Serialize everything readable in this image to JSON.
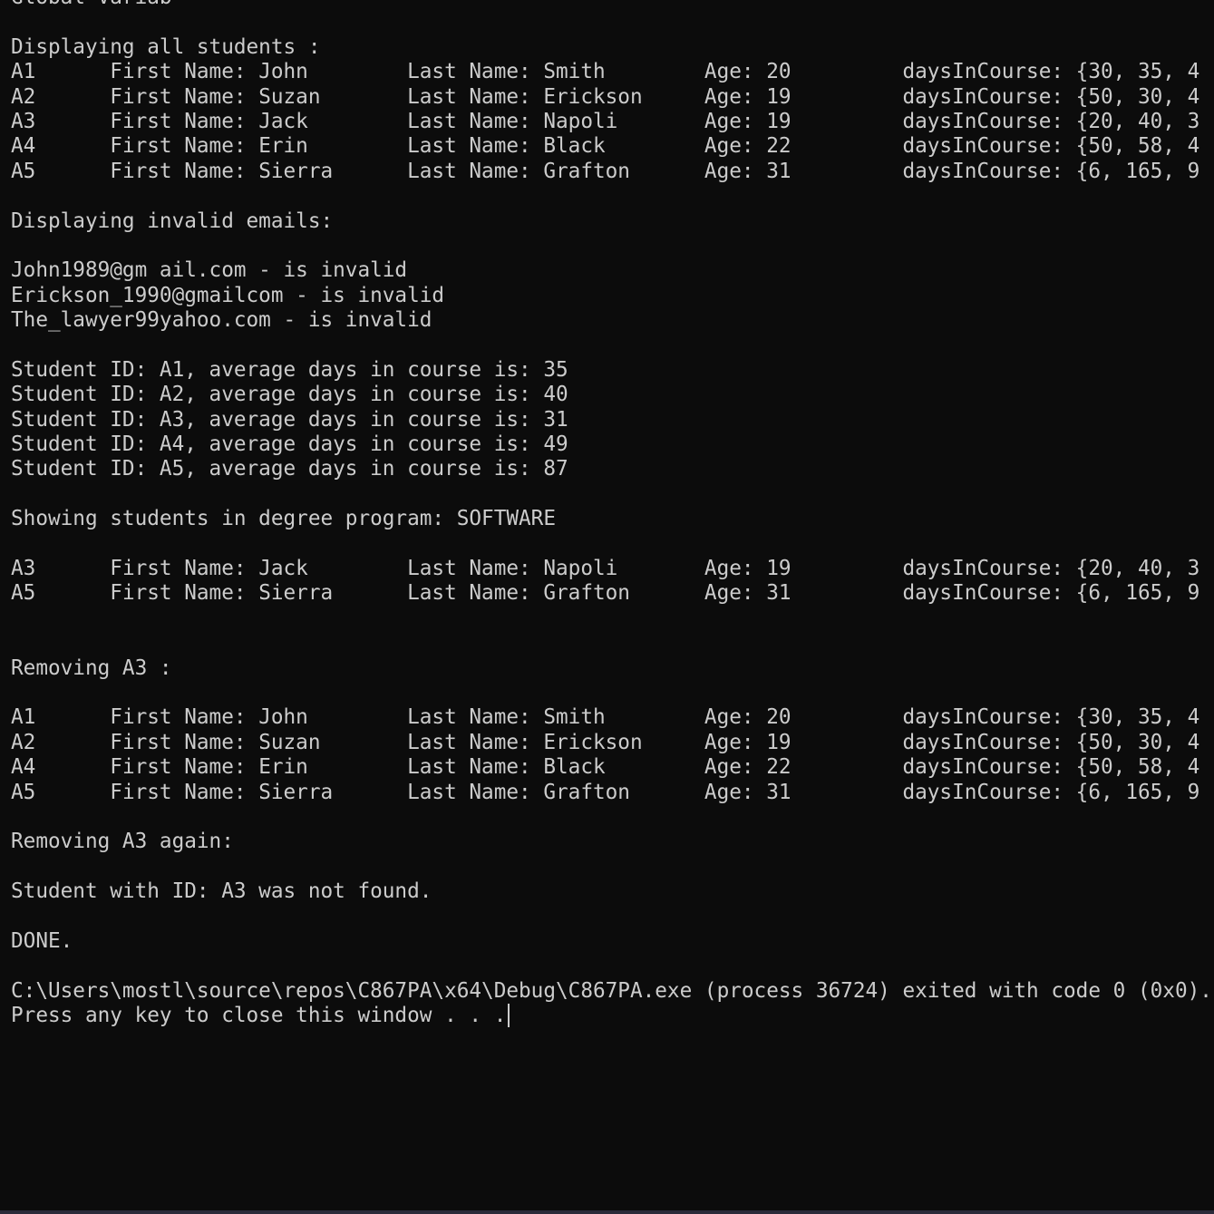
{
  "terminal": {
    "colors": {
      "background": "#0c0c0c",
      "foreground": "#cccccc"
    },
    "lines": [
      "Global Variab",
      "",
      "Displaying all students :",
      "A1\tFirst Name: John\tLast Name: Smith\tAge: 20\t\tdaysInCourse: {30, 35, 4",
      "A2\tFirst Name: Suzan\tLast Name: Erickson\tAge: 19\t\tdaysInCourse: {50, 30, 4",
      "A3\tFirst Name: Jack\tLast Name: Napoli\tAge: 19\t\tdaysInCourse: {20, 40, 3",
      "A4\tFirst Name: Erin\tLast Name: Black\tAge: 22\t\tdaysInCourse: {50, 58, 4",
      "A5\tFirst Name: Sierra\tLast Name: Grafton\tAge: 31\t\tdaysInCourse: {6, 165, 9",
      "",
      "Displaying invalid emails:",
      "",
      "John1989@gm ail.com - is invalid",
      "Erickson_1990@gmailcom - is invalid",
      "The_lawyer99yahoo.com - is invalid",
      "",
      "Student ID: A1, average days in course is: 35",
      "Student ID: A2, average days in course is: 40",
      "Student ID: A3, average days in course is: 31",
      "Student ID: A4, average days in course is: 49",
      "Student ID: A5, average days in course is: 87",
      "",
      "Showing students in degree program: SOFTWARE",
      "",
      "A3\tFirst Name: Jack\tLast Name: Napoli\tAge: 19\t\tdaysInCourse: {20, 40, 3",
      "A5\tFirst Name: Sierra\tLast Name: Grafton\tAge: 31\t\tdaysInCourse: {6, 165, 9",
      "",
      "",
      "Removing A3 :",
      "",
      "A1\tFirst Name: John\tLast Name: Smith\tAge: 20\t\tdaysInCourse: {30, 35, 4",
      "A2\tFirst Name: Suzan\tLast Name: Erickson\tAge: 19\t\tdaysInCourse: {50, 30, 4",
      "A4\tFirst Name: Erin\tLast Name: Black\tAge: 22\t\tdaysInCourse: {50, 58, 4",
      "A5\tFirst Name: Sierra\tLast Name: Grafton\tAge: 31\t\tdaysInCourse: {6, 165, 9",
      "",
      "Removing A3 again:",
      "",
      "Student with ID: A3 was not found.",
      "",
      "DONE.",
      "",
      "C:\\Users\\mostl\\source\\repos\\C867PA\\x64\\Debug\\C867PA.exe (process 36724) exited with code 0 (0x0).",
      "Press any key to close this window . . ."
    ]
  }
}
